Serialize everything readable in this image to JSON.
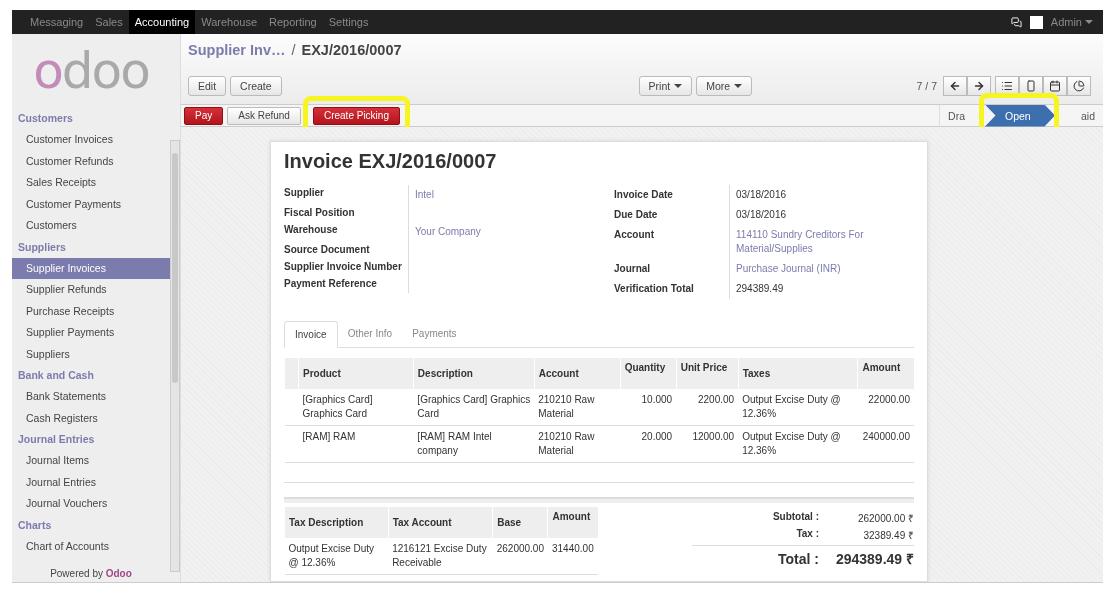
{
  "top_menu": [
    {
      "label": "Messaging",
      "selected": false
    },
    {
      "label": "Sales",
      "selected": false
    },
    {
      "label": "Accounting",
      "selected": true
    },
    {
      "label": "Warehouse",
      "selected": false
    },
    {
      "label": "Reporting",
      "selected": false
    },
    {
      "label": "Settings",
      "selected": false
    }
  ],
  "user": {
    "name": "Admin"
  },
  "sidebar": {
    "logo": "odoo",
    "sections": [
      {
        "title": "Customers",
        "items": [
          {
            "label": "Customer Invoices",
            "selected": false
          },
          {
            "label": "Customer Refunds",
            "selected": false
          },
          {
            "label": "Sales Receipts",
            "selected": false
          },
          {
            "label": "Customer Payments",
            "selected": false
          },
          {
            "label": "Customers",
            "selected": false
          }
        ]
      },
      {
        "title": "Suppliers",
        "items": [
          {
            "label": "Supplier Invoices",
            "selected": true
          },
          {
            "label": "Supplier Refunds",
            "selected": false
          },
          {
            "label": "Purchase Receipts",
            "selected": false
          },
          {
            "label": "Supplier Payments",
            "selected": false
          },
          {
            "label": "Suppliers",
            "selected": false
          }
        ]
      },
      {
        "title": "Bank and Cash",
        "items": [
          {
            "label": "Bank Statements",
            "selected": false
          },
          {
            "label": "Cash Registers",
            "selected": false
          }
        ]
      },
      {
        "title": "Journal Entries",
        "items": [
          {
            "label": "Journal Items",
            "selected": false
          },
          {
            "label": "Journal Entries",
            "selected": false
          },
          {
            "label": "Journal Vouchers",
            "selected": false
          }
        ]
      },
      {
        "title": "Charts",
        "items": [
          {
            "label": "Chart of Accounts",
            "selected": false
          }
        ]
      }
    ],
    "footer": {
      "text": "Powered by",
      "brand": "Odoo"
    }
  },
  "breadcrumb": {
    "parent": "Supplier Inv…",
    "separator": "/",
    "current": "EXJ/2016/0007"
  },
  "toolbar": {
    "left": [
      "Edit",
      "Create"
    ],
    "center": [
      "Print",
      "More"
    ],
    "pager": "7 / 7"
  },
  "actions": [
    {
      "label": "Pay",
      "kind": "primary",
      "highlighted": false
    },
    {
      "label": "Ask Refund",
      "kind": "default",
      "highlighted": false
    },
    {
      "label": "Create Picking",
      "kind": "primary",
      "highlighted": true
    }
  ],
  "status_steps": [
    {
      "label": "Dra",
      "selected": false,
      "highlighted": false
    },
    {
      "label": "Open",
      "selected": true,
      "highlighted": true
    },
    {
      "label": "aid",
      "selected": false,
      "highlighted": false
    }
  ],
  "invoice": {
    "title": "Invoice EXJ/2016/0007",
    "left_fields": [
      {
        "label": "Supplier",
        "value": "Intel"
      },
      {
        "label": "Fiscal Position"
      },
      {
        "label": "Warehouse",
        "value": "Your Company"
      },
      {
        "label": "Source Document"
      },
      {
        "label": "Supplier Invoice Number"
      },
      {
        "label": "Payment Reference"
      }
    ],
    "right_fields": [
      {
        "label": "Invoice Date",
        "value": "03/18/2016",
        "link": false
      },
      {
        "label": "Due Date",
        "value": "03/18/2016",
        "link": false
      },
      {
        "label": "Account",
        "value": "114110 Sundry Creditors For Material/Supplies",
        "link": true
      },
      {
        "label": "Journal",
        "value": "Purchase Journal (INR)",
        "link": true
      },
      {
        "label": "Verification Total",
        "value": "294389.49",
        "link": false
      }
    ],
    "tabs": [
      {
        "label": "Invoice",
        "selected": true
      },
      {
        "label": "Other Info",
        "selected": false
      },
      {
        "label": "Payments",
        "selected": false
      }
    ],
    "lines": {
      "columns": [
        "Product",
        "Description",
        "Account",
        "Quantity",
        "Unit Price",
        "Taxes",
        "Amount"
      ],
      "rows": [
        [
          "[Graphics Card] Graphics Card",
          "[Graphics Card] Graphics Card",
          "210210 Raw Material",
          "10.000",
          "2200.00",
          "Output Excise Duty @ 12.36%",
          "22000.00"
        ],
        [
          "[RAM] RAM",
          "[RAM] RAM Intel company",
          "210210 Raw Material",
          "20.000",
          "12000.00",
          "Output Excise Duty @ 12.36%",
          "240000.00"
        ]
      ]
    },
    "taxes": {
      "columns": [
        "Tax Description",
        "Tax Account",
        "Base",
        "Amount"
      ],
      "rows": [
        [
          "Output Excise Duty @ 12.36%",
          "1216121 Excise Duty Receivable",
          "262000.00",
          "31440.00"
        ]
      ]
    },
    "totals": [
      {
        "label": "Subtotal :",
        "value": "262000.00 ₹"
      },
      {
        "label": "Tax :",
        "value": "32389.49 ₹"
      }
    ],
    "total": {
      "label": "Total :",
      "value": "294389.49 ₹"
    }
  }
}
